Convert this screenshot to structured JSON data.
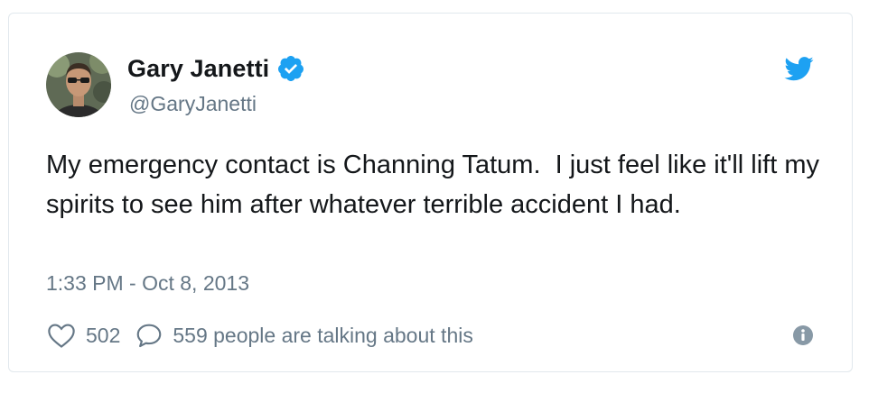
{
  "tweet": {
    "author": {
      "display_name": "Gary Janetti",
      "handle": "@GaryJanetti",
      "verified": true,
      "avatar_icon": "avatar-photo"
    },
    "text": "My emergency contact is Channing Tatum.  I just feel like it'll lift my spirits to see him after whatever terrible accident I had.",
    "timestamp": "1:33 PM - Oct 8, 2013",
    "likes": "502",
    "conversation": "559 people are talking about this"
  },
  "icons": {
    "brand": "twitter-bird-icon",
    "verified": "verified-badge-icon",
    "like": "heart-icon",
    "reply": "speech-bubble-icon",
    "info": "info-icon"
  },
  "colors": {
    "brand_blue": "#1da1f2",
    "text": "#14171a",
    "muted": "#657786",
    "border": "#e1e8ed"
  }
}
